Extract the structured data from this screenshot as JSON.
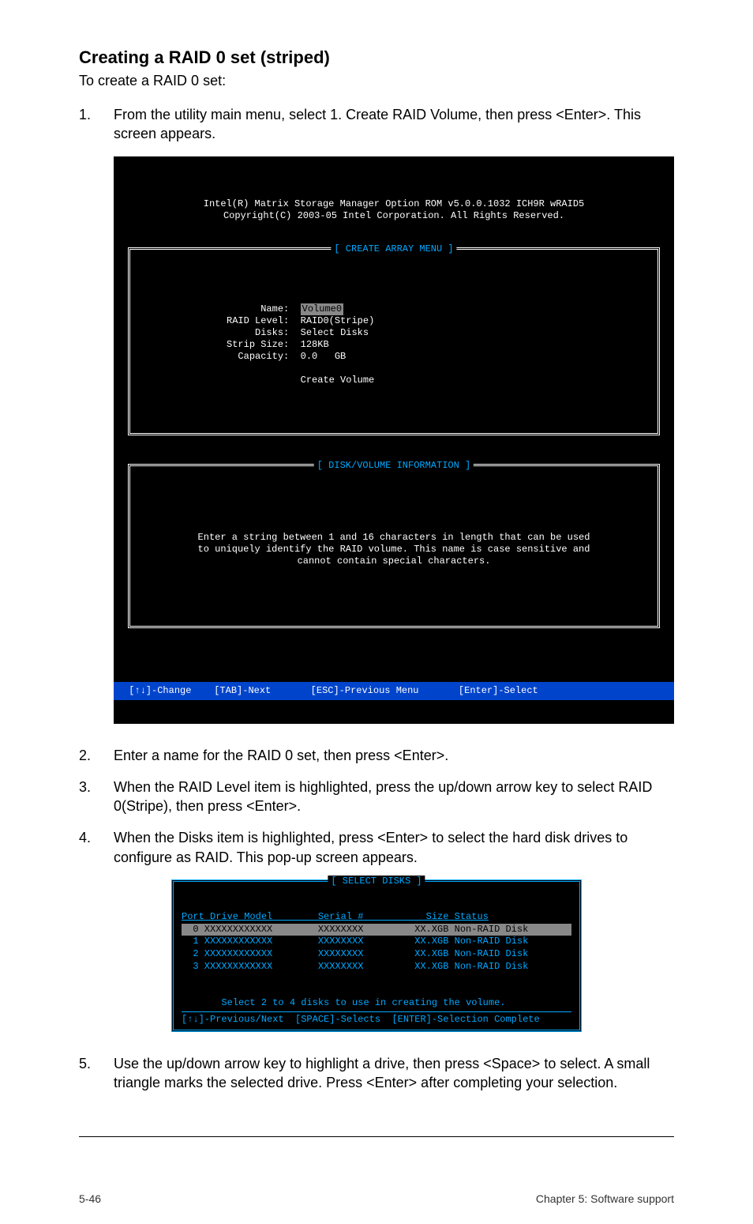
{
  "section": {
    "title": "Creating a RAID 0 set (striped)",
    "intro": "To create a RAID 0 set:"
  },
  "steps": {
    "s1": "From the utility main menu, select 1. Create RAID Volume, then press <Enter>. This screen appears.",
    "s2": "Enter a name for the RAID 0 set, then press <Enter>.",
    "s3": "When the RAID Level item is highlighted, press the up/down arrow key to select RAID 0(Stripe), then press <Enter>.",
    "s4": "When the Disks item is highlighted, press <Enter> to select the hard disk drives to configure as RAID. This pop-up screen appears.",
    "s5": "Use the up/down arrow key to highlight a drive, then press <Space>  to select. A small triangle marks the selected drive. Press <Enter> after completing your selection."
  },
  "terminal": {
    "header1": "Intel(R) Matrix Storage Manager Option ROM v5.0.0.1032 ICH9R wRAID5",
    "header2": "Copyright(C) 2003-05 Intel Corporation. All Rights Reserved.",
    "create_label": "[ CREATE ARRAY MENU ]",
    "name_label": "Name:",
    "name_value": "Volume0",
    "raid_label": "RAID Level:",
    "raid_value": "RAID0(Stripe)",
    "disks_label": "Disks:",
    "disks_value": "Select Disks",
    "strip_label": "Strip Size:",
    "strip_value": "128KB",
    "capacity_label": "Capacity:",
    "capacity_value": "0.0   GB",
    "create_volume": "Create Volume",
    "disk_info_label": "[ DISK/VOLUME INFORMATION ]",
    "info_line1": "Enter a string between 1 and 16 characters in length that can be used",
    "info_line2": "to uniquely identify the RAID volume. This name is case sensitive and",
    "info_line3": "cannot contain special characters.",
    "foot_change": "[↑↓]-Change",
    "foot_next": "[TAB]-Next",
    "foot_prev": "[ESC]-Previous Menu",
    "foot_select": "[Enter]-Select"
  },
  "select_disks": {
    "title": "[ SELECT DISKS ]",
    "header": "Port Drive Model        Serial #           Size Status",
    "row0": "  0 XXXXXXXXXXXX        XXXXXXXX         XX.XGB Non-RAID Disk",
    "row1": "  1 XXXXXXXXXXXX        XXXXXXXX         XX.XGB Non-RAID Disk",
    "row2": "  2 XXXXXXXXXXXX        XXXXXXXX         XX.XGB Non-RAID Disk",
    "row3": "  3 XXXXXXXXXXXX        XXXXXXXX         XX.XGB Non-RAID Disk",
    "instruction": "Select 2 to 4 disks to use in creating the volume.",
    "footer": "[↑↓]-Previous/Next  [SPACE]-Selects  [ENTER]-Selection Complete"
  },
  "page_footer": {
    "left": "5-46",
    "right": "Chapter 5: Software support"
  }
}
